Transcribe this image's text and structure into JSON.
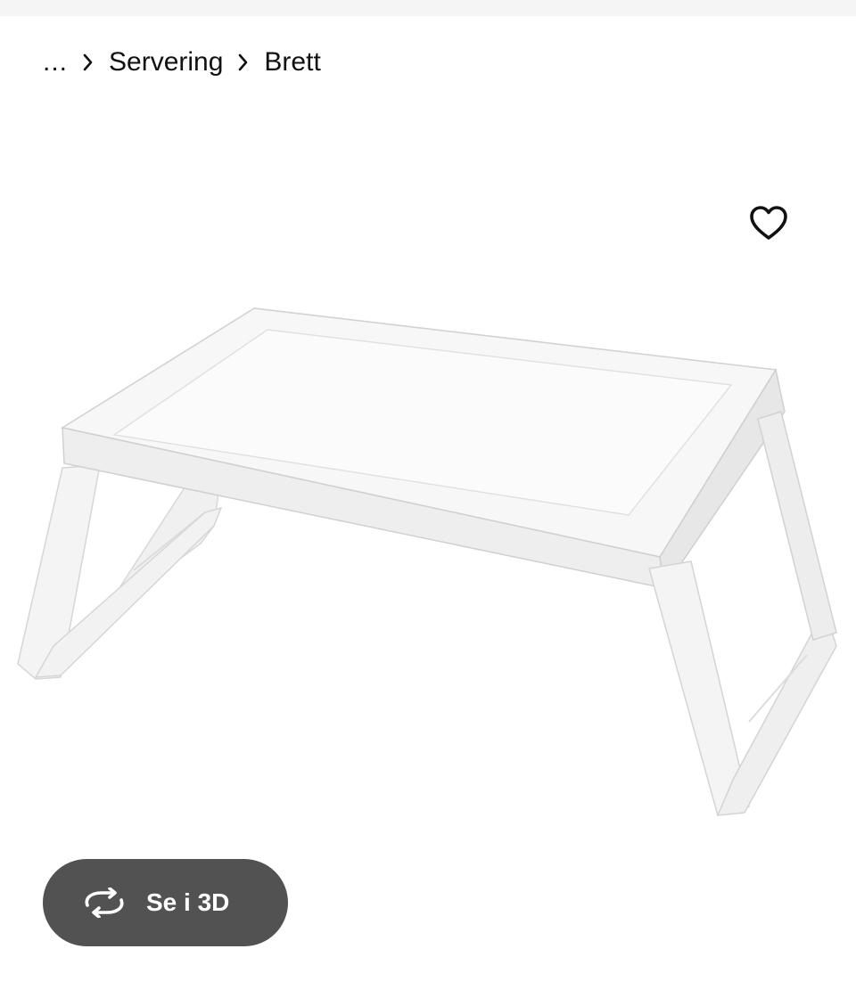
{
  "breadcrumb": {
    "items": [
      {
        "label": "..."
      },
      {
        "label": "Servering"
      },
      {
        "label": "Brett"
      }
    ]
  },
  "product": {
    "image_icon": "bed-tray-product-image",
    "favorite_icon": "heart-icon"
  },
  "view3d": {
    "label": "Se i 3D",
    "icon": "rotate-3d-icon",
    "background": "#525252"
  }
}
